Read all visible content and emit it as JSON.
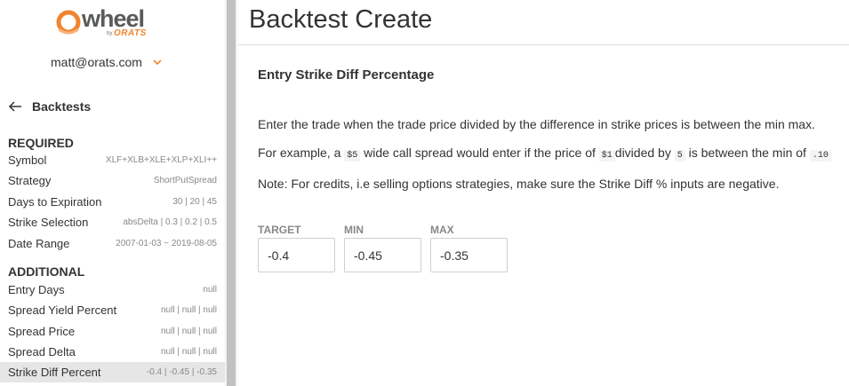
{
  "logo": {
    "text": "wheel",
    "by": "by",
    "brand": "ORATS"
  },
  "user": {
    "email": "matt@orats.com"
  },
  "nav": {
    "back_label": "Backtests"
  },
  "sidebar": {
    "required_title": "REQUIRED",
    "required": [
      {
        "label": "Symbol",
        "value": "XLF+XLB+XLE+XLP+XLI++"
      },
      {
        "label": "Strategy",
        "value": "ShortPutSpread"
      },
      {
        "label": "Days to Expiration",
        "value": "30 | 20 | 45"
      },
      {
        "label": "Strike Selection",
        "value": "absDelta | 0.3 | 0.2 | 0.5"
      },
      {
        "label": "Date Range",
        "value": "2007-01-03 ~ 2019-08-05"
      }
    ],
    "additional_title": "ADDITIONAL",
    "additional": [
      {
        "label": "Entry Days",
        "value": "null"
      },
      {
        "label": "Spread Yield Percent",
        "value": "null | null | null"
      },
      {
        "label": "Spread Price",
        "value": "null | null | null"
      },
      {
        "label": "Spread Delta",
        "value": "null | null | null"
      },
      {
        "label": "Strike Diff Percent",
        "value": "-0.4 | -0.45 | -0.35"
      }
    ]
  },
  "main": {
    "title": "Backtest Create",
    "field_title": "Entry Strike Diff Percentage",
    "desc1": "Enter the trade when the trade price divided by the difference in strike prices is between the min max.",
    "desc2": {
      "part1": "For example, a",
      "code1": "$5",
      "part2": "wide call spread would enter if the price of",
      "code2": "$1",
      "part3": "divided by",
      "code3": "5",
      "part4": "is between the min of",
      "code4": ".10"
    },
    "desc3": "Note: For credits, i.e selling options strategies, make sure the Strike Diff % inputs are negative.",
    "inputs": {
      "target": {
        "label": "TARGET",
        "value": "-0.4"
      },
      "min": {
        "label": "MIN",
        "value": "-0.45"
      },
      "max": {
        "label": "MAX",
        "value": "-0.35"
      }
    }
  },
  "colors": {
    "brand_orange": "#f0852d",
    "active_row": "#e6e6e6",
    "text": "#333333",
    "muted": "#888888"
  }
}
